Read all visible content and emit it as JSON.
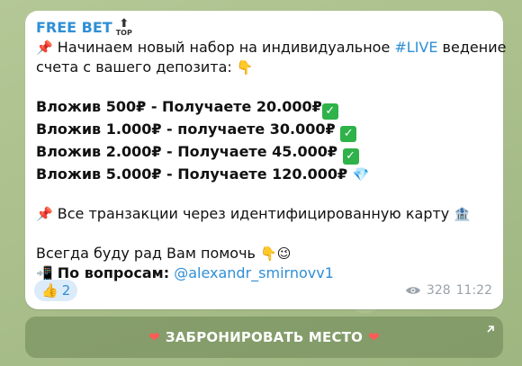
{
  "message": {
    "sender": "FREE BET",
    "sender_badge_text": "TOP",
    "line1_prefix": "Начинаем новый набор на индивидуальное ",
    "hashtag": "#LIVE",
    "line1_suffix": " ведение",
    "line2": "счета с вашего депозита:",
    "offers": [
      "Вложив 500₽ - Получаете 20.000₽",
      "Вложив 1.000₽ - получаете 30.000₽",
      "Вложив 2.000₽ - Получаете 45.000₽",
      "Вложив 5.000₽ - Получаете 120.000₽"
    ],
    "transactions": "Все транзакции через идентифицированную карту",
    "help": "Всегда буду рад Вам помочь",
    "questions_label": "По вопросам:",
    "mention": "@alexandr_smirnovv1"
  },
  "footer": {
    "reaction_count": "2",
    "views": "328",
    "time": "11:22"
  },
  "cta": {
    "label": "ЗАБРОНИРОВАТЬ МЕСТО"
  },
  "icons": {
    "pin": "pushpin-icon",
    "pointing_down": "pointing-down-icon",
    "check": "check-mark-icon",
    "diamond": "diamond-icon",
    "bank": "bank-icon",
    "wink": "wink-icon",
    "phone": "mobile-phone-icon",
    "thumbs_up": "thumbs-up-icon",
    "heart": "heart-icon",
    "eye": "eye-icon"
  },
  "colors": {
    "accent": "#2f8fd6",
    "check": "#2fb24a"
  }
}
